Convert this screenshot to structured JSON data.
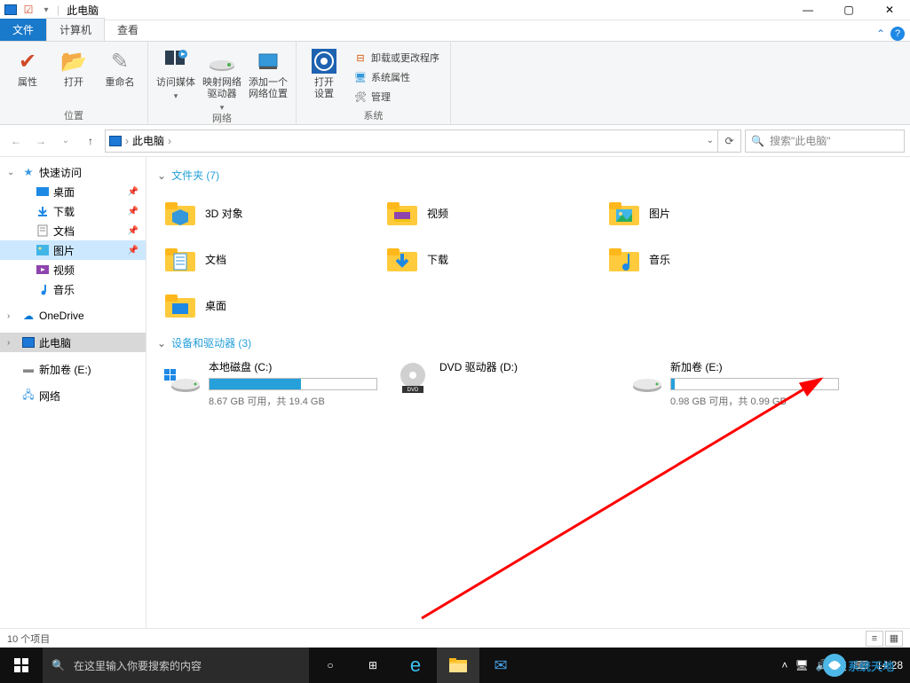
{
  "window": {
    "title": "此电脑"
  },
  "ribbon": {
    "tabs": {
      "file": "文件",
      "computer": "计算机",
      "view": "查看"
    },
    "groups": {
      "location": {
        "label": "位置",
        "buttons": {
          "properties": "属性",
          "open": "打开",
          "rename": "重命名"
        }
      },
      "network": {
        "label": "网络",
        "buttons": {
          "media": "访问媒体",
          "mapDrive": "映射网络\n驱动器",
          "addLocation": "添加一个\n网络位置"
        }
      },
      "system": {
        "label": "系统",
        "buttons": {
          "openSettings": "打开\n设置",
          "uninstall": "卸载或更改程序",
          "sysProps": "系统属性",
          "manage": "管理"
        }
      }
    }
  },
  "address": {
    "crumb1": "此电脑",
    "searchPlaceholder": "搜索\"此电脑\""
  },
  "nav": {
    "quickAccess": "快速访问",
    "items": [
      {
        "label": "桌面",
        "pinned": true,
        "icon": "desktop"
      },
      {
        "label": "下载",
        "pinned": true,
        "icon": "downloads"
      },
      {
        "label": "文档",
        "pinned": true,
        "icon": "documents"
      },
      {
        "label": "图片",
        "pinned": true,
        "icon": "pictures",
        "selected": true
      },
      {
        "label": "视频",
        "pinned": false,
        "icon": "videos"
      },
      {
        "label": "音乐",
        "pinned": false,
        "icon": "music"
      }
    ],
    "onedrive": "OneDrive",
    "thispc": "此电脑",
    "newvolume": "新加卷 (E:)",
    "network": "网络"
  },
  "content": {
    "foldersHeader": "文件夹 (7)",
    "folders": [
      {
        "label": "3D 对象",
        "icon": "3d"
      },
      {
        "label": "视频",
        "icon": "videos"
      },
      {
        "label": "图片",
        "icon": "pictures"
      },
      {
        "label": "文档",
        "icon": "documents"
      },
      {
        "label": "下载",
        "icon": "downloads"
      },
      {
        "label": "音乐",
        "icon": "music"
      },
      {
        "label": "桌面",
        "icon": "desktop"
      }
    ],
    "drivesHeader": "设备和驱动器 (3)",
    "drives": [
      {
        "name": "本地磁盘 (C:)",
        "free": "8.67 GB 可用，共 19.4 GB",
        "fillPct": 55,
        "icon": "os-drive",
        "hasBar": true
      },
      {
        "name": "DVD 驱动器 (D:)",
        "free": "",
        "fillPct": 0,
        "icon": "dvd",
        "hasBar": false
      },
      {
        "name": "新加卷 (E:)",
        "free": "0.98 GB 可用，共 0.99 GB",
        "fillPct": 2,
        "icon": "drive",
        "hasBar": true
      }
    ]
  },
  "status": {
    "itemCount": "10 个项目"
  },
  "taskbar": {
    "searchPlaceholder": "在这里输入你要搜索的内容",
    "ime": "英",
    "time": "14:28"
  },
  "watermark": "系统天地"
}
